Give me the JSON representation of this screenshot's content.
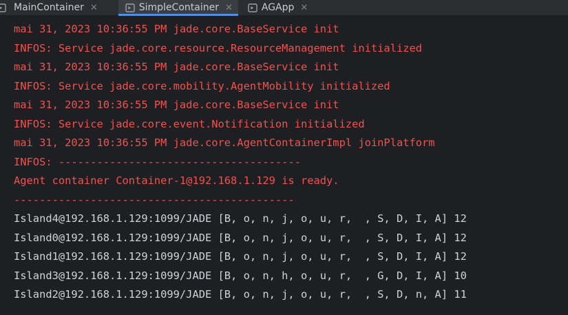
{
  "tabs": [
    {
      "label": "MainContainer",
      "active": false
    },
    {
      "label": "SimpleContainer",
      "active": true
    },
    {
      "label": "AGApp",
      "active": false
    }
  ],
  "colors": {
    "error_text": "#f0524f",
    "normal_text": "#cfd3d8",
    "active_tab_underline": "#4e8ee3",
    "console_bg": "#1e1f22"
  },
  "console": {
    "lines": [
      {
        "text": "mai 31, 2023 10:36:55 PM jade.core.BaseService init",
        "kind": "stderr"
      },
      {
        "text": "INFOS: Service jade.core.resource.ResourceManagement initialized",
        "kind": "stderr"
      },
      {
        "text": "mai 31, 2023 10:36:55 PM jade.core.BaseService init",
        "kind": "stderr"
      },
      {
        "text": "INFOS: Service jade.core.mobility.AgentMobility initialized",
        "kind": "stderr"
      },
      {
        "text": "mai 31, 2023 10:36:55 PM jade.core.BaseService init",
        "kind": "stderr"
      },
      {
        "text": "INFOS: Service jade.core.event.Notification initialized",
        "kind": "stderr"
      },
      {
        "text": "mai 31, 2023 10:36:55 PM jade.core.AgentContainerImpl joinPlatform",
        "kind": "stderr"
      },
      {
        "text": "INFOS: --------------------------------------",
        "kind": "stderr"
      },
      {
        "text": "Agent container Container-1@192.168.1.129 is ready.",
        "kind": "stderr"
      },
      {
        "text": "--------------------------------------------",
        "kind": "stderr"
      },
      {
        "text": "Island4@192.168.1.129:1099/JADE [B, o, n, j, o, u, r,  , S, D, I, A] 12",
        "kind": "stdout"
      },
      {
        "text": "Island0@192.168.1.129:1099/JADE [B, o, n, j, o, u, r,  , S, D, I, A] 12",
        "kind": "stdout"
      },
      {
        "text": "Island1@192.168.1.129:1099/JADE [B, o, n, j, o, u, r,  , S, D, I, A] 12",
        "kind": "stdout"
      },
      {
        "text": "Island3@192.168.1.129:1099/JADE [B, o, n, h, o, u, r,  , G, D, I, A] 10",
        "kind": "stdout"
      },
      {
        "text": "Island2@192.168.1.129:1099/JADE [B, o, n, j, o, u, r,  , S, D, n, A] 11",
        "kind": "stdout"
      }
    ]
  }
}
